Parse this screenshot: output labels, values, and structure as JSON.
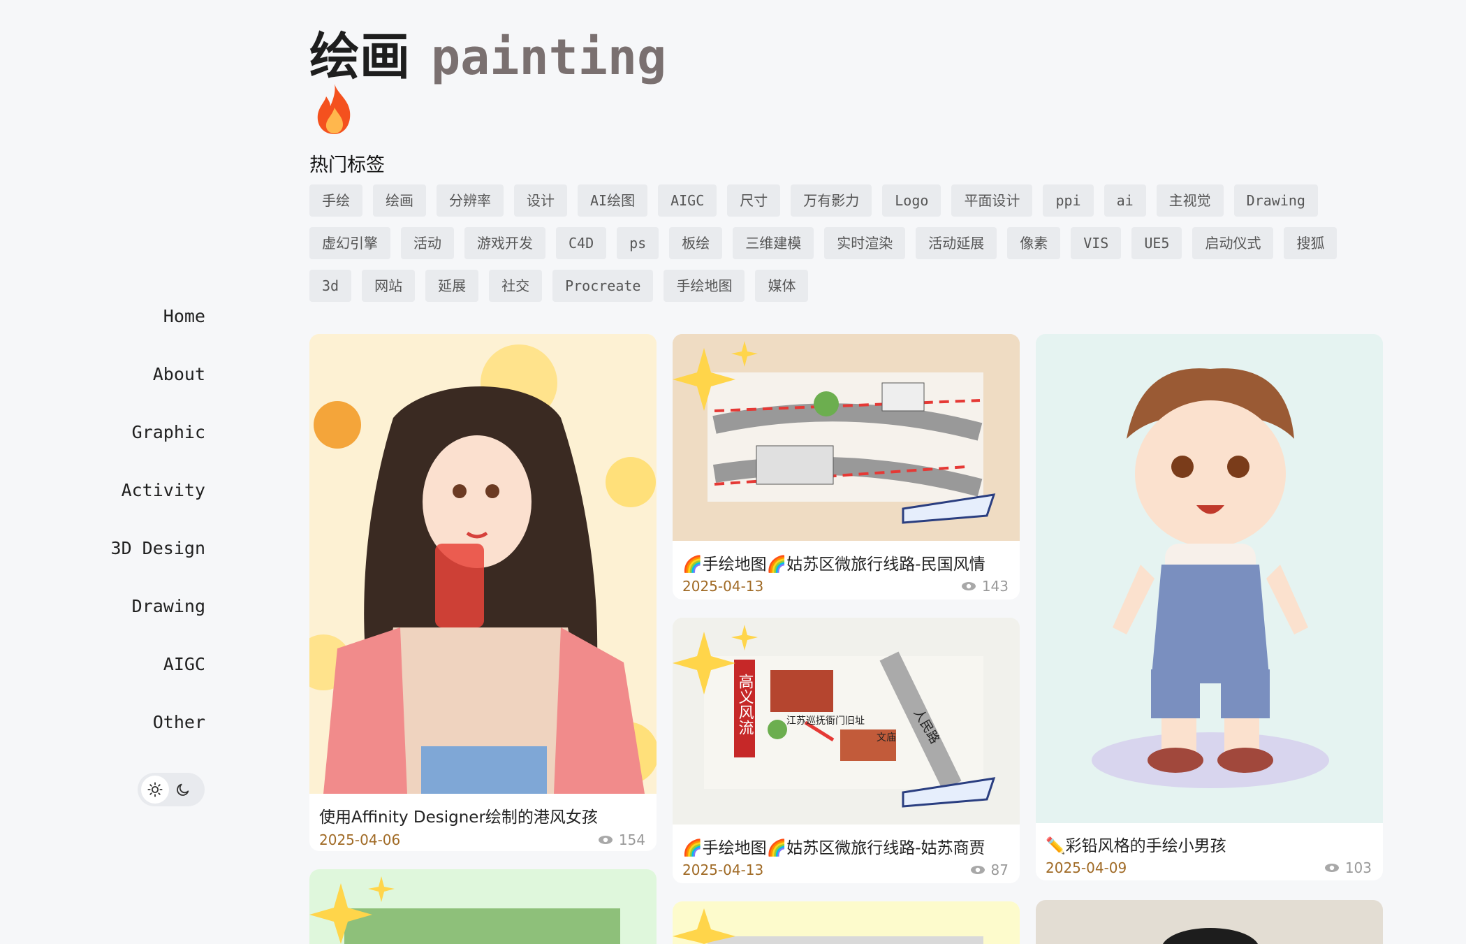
{
  "header": {
    "title_cn": "绘画",
    "title_en": "painting",
    "hot_tags_label": "热门标签"
  },
  "nav": {
    "items": [
      "Home",
      "About",
      "Graphic",
      "Activity",
      "3D Design",
      "Drawing",
      "AIGC",
      "Other"
    ]
  },
  "tags": [
    "手绘",
    "绘画",
    "分辨率",
    "设计",
    "AI绘图",
    "AIGC",
    "尺寸",
    "万有影力",
    "Logo",
    "平面设计",
    "ppi",
    "ai",
    "主视觉",
    "Drawing",
    "虚幻引擎",
    "活动",
    "游戏开发",
    "C4D",
    "ps",
    "板绘",
    "三维建模",
    "实时渲染",
    "活动延展",
    "像素",
    "VIS",
    "UE5",
    "启动仪式",
    "搜狐",
    "3d",
    "网站",
    "延展",
    "社交",
    "Procreate",
    "手绘地图",
    "媒体"
  ],
  "cards": [
    {
      "title": "使用Affinity Designer绘制的港风女孩",
      "date": "2025-04-06",
      "views": "154"
    },
    {
      "title": "🌈手绘地图🌈姑苏区微旅行线路-民国风情",
      "date": "2025-04-13",
      "views": "143"
    },
    {
      "title": "🌈手绘地图🌈姑苏区微旅行线路-姑苏商贾",
      "date": "2025-04-13",
      "views": "87"
    },
    {
      "title": "✏️彩铅风格的手绘小男孩",
      "date": "2025-04-09",
      "views": "103"
    }
  ],
  "map_labels": {
    "road1": "高义风流",
    "place1": "江苏巡抚衙门旧址",
    "place2": "文庙",
    "road2": "人民路"
  },
  "colors": {
    "accent_date": "#a06a25",
    "tag_bg": "#e9ebee",
    "bg": "#f6f7f9"
  },
  "icons": {
    "fire": "fire-icon",
    "sun": "sun-icon",
    "moon": "moon-icon",
    "eye": "eye-icon"
  }
}
